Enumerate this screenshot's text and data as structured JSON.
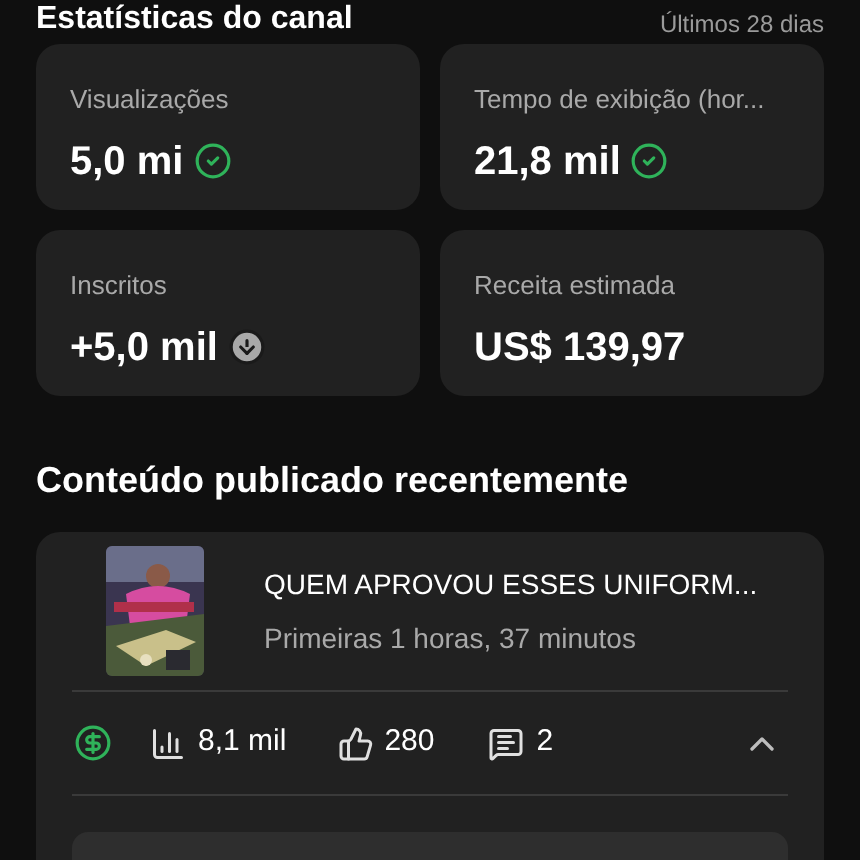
{
  "header": {
    "title": "Estatísticas do canal",
    "period": "Últimos 28 dias"
  },
  "metrics": [
    {
      "label": "Visualizações",
      "value": "5,0 mi",
      "kind": "check"
    },
    {
      "label": "Tempo de exibição (hor...",
      "value": "21,8 mil",
      "kind": "check"
    },
    {
      "label": "Inscritos",
      "value": "+5,0 mil",
      "kind": "down"
    },
    {
      "label": "Receita estimada",
      "value": "US$ 139,97",
      "kind": "plain"
    }
  ],
  "recent": {
    "title": "Conteúdo publicado recentemente",
    "video": {
      "title": "QUEM APROVOU ESSES UNIFORM...",
      "subtitle": "Primeiras 1 horas, 37 minutos",
      "monetized": true,
      "views": "8,1 mil",
      "likes": "280",
      "comments": "2",
      "expanded": true
    }
  }
}
